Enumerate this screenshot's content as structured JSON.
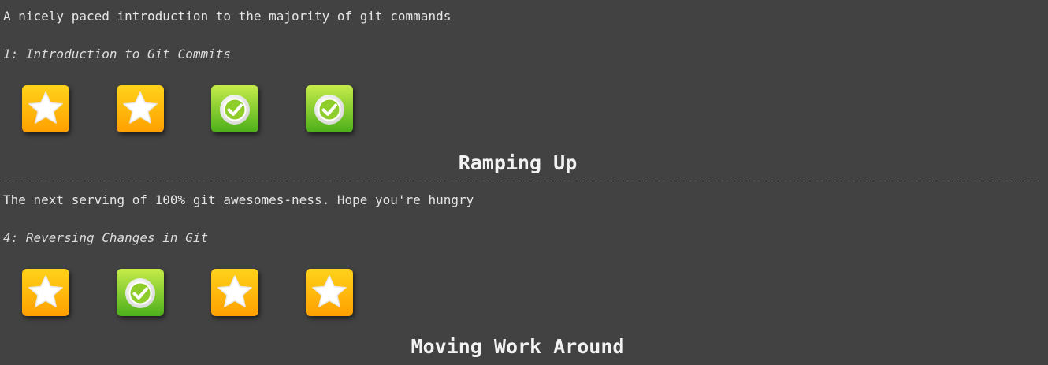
{
  "sequences": [
    {
      "description": "A nicely paced introduction to the majority of git commands",
      "level_name": "1: Introduction to Git Commits",
      "levels": [
        {
          "status": "star-icon"
        },
        {
          "status": "star-icon"
        },
        {
          "status": "check-icon"
        },
        {
          "status": "check-icon"
        }
      ]
    },
    {
      "title": "Ramping Up",
      "description": "The next serving of 100% git awesomes-ness. Hope you're hungry",
      "level_name": "4: Reversing Changes in Git",
      "levels": [
        {
          "status": "star-icon"
        },
        {
          "status": "check-icon"
        },
        {
          "status": "star-icon"
        },
        {
          "status": "star-icon"
        }
      ]
    },
    {
      "title": "Moving Work Around"
    }
  ],
  "colors": {
    "background": "#424242",
    "star_tile_top": "#ffd21a",
    "star_tile_bottom": "#ffa000",
    "check_tile_top": "#c6ec4a",
    "check_tile_bottom": "#4caf1a"
  }
}
